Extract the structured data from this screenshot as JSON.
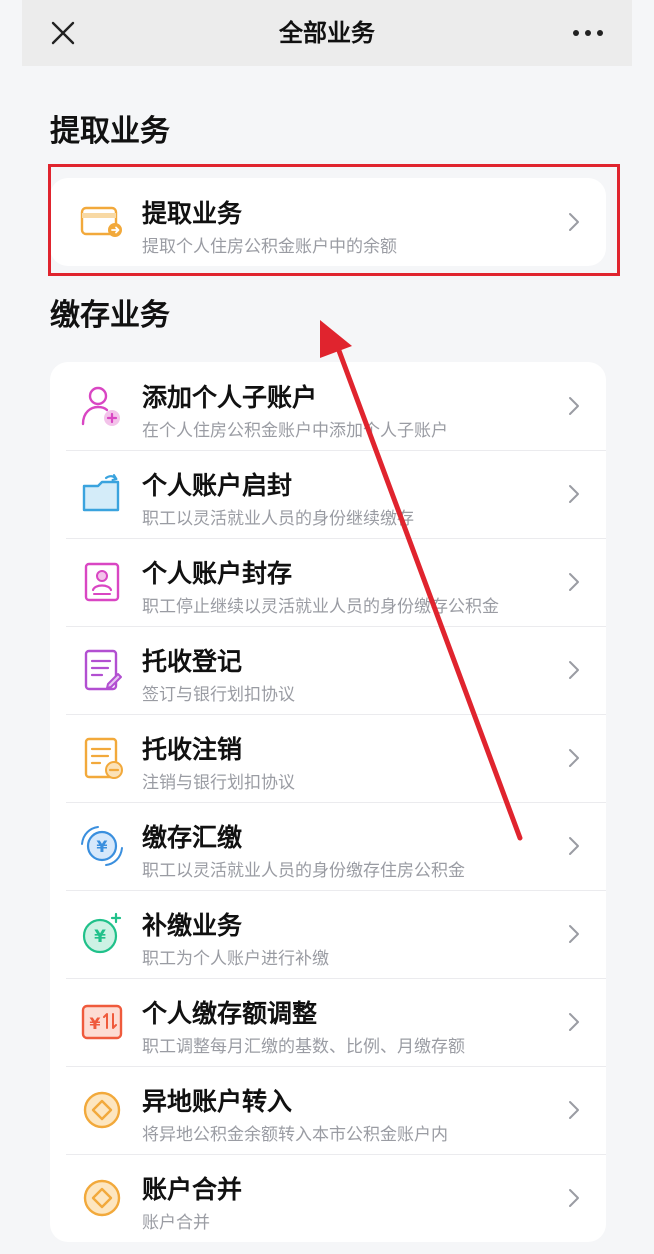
{
  "header": {
    "title": "全部业务",
    "close_icon": "close-icon",
    "more_icon": "more-icon"
  },
  "sections": [
    {
      "title": "提取业务",
      "items": [
        {
          "title": "提取业务",
          "subtitle": "提取个人住房公积金账户中的余额",
          "icon": "card-withdraw-icon",
          "color": "#f2a93b"
        }
      ]
    },
    {
      "title": "缴存业务",
      "items": [
        {
          "title": "添加个人子账户",
          "subtitle": "在个人住房公积金账户中添加个人子账户",
          "icon": "user-add-icon",
          "color": "#d946c3"
        },
        {
          "title": "个人账户启封",
          "subtitle": "职工以灵活就业人员的身份继续缴存",
          "icon": "folder-open-icon",
          "color": "#3aa3de"
        },
        {
          "title": "个人账户封存",
          "subtitle": "职工停止继续以灵活就业人员的身份缴存公积金",
          "icon": "id-card-icon",
          "color": "#d946c3"
        },
        {
          "title": "托收登记",
          "subtitle": "签订与银行划扣协议",
          "icon": "document-edit-icon",
          "color": "#b24fd1"
        },
        {
          "title": "托收注销",
          "subtitle": "注销与银行划扣协议",
          "icon": "document-minus-icon",
          "color": "#f2a93b"
        },
        {
          "title": "缴存汇缴",
          "subtitle": "职工以灵活就业人员的身份缴存住房公积金",
          "icon": "yuan-cycle-icon",
          "color": "#3a8fde"
        },
        {
          "title": "补缴业务",
          "subtitle": "职工为个人账户进行补缴",
          "icon": "yuan-plus-icon",
          "color": "#20c18a"
        },
        {
          "title": "个人缴存额调整",
          "subtitle": "职工调整每月汇缴的基数、比例、月缴存额",
          "icon": "yuan-adjust-icon",
          "color": "#ef5a3c"
        },
        {
          "title": "异地账户转入",
          "subtitle": "将异地公积金余额转入本市公积金账户内",
          "icon": "coin-diamond-icon",
          "color": "#f2a93b"
        },
        {
          "title": "账户合并",
          "subtitle": "账户合并",
          "icon": "coin-diamond-icon",
          "color": "#f2a93b"
        }
      ]
    }
  ],
  "annotation": {
    "highlight_color": "#e0242e",
    "arrow_color": "#e0242e"
  }
}
